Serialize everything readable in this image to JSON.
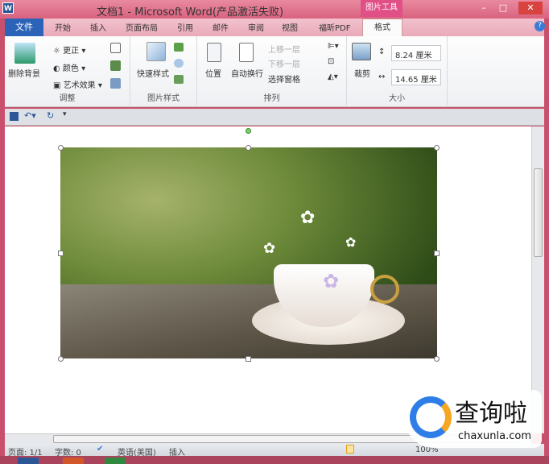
{
  "title": "文档1 - Microsoft Word(产品激活失败)",
  "context_tab": "图片工具",
  "window": {
    "minimize": "–",
    "maximize": "□",
    "close": "✕"
  },
  "tabs": [
    "文件",
    "开始",
    "插入",
    "页面布局",
    "引用",
    "邮件",
    "审阅",
    "视图",
    "福昕PDF",
    "格式"
  ],
  "ribbon": {
    "adjust": {
      "remove_bg": "删除背景",
      "corrections": "更正",
      "color": "颜色",
      "artistic": "艺术效果",
      "label": "调整"
    },
    "styles": {
      "quick": "快速样式",
      "label": "图片样式"
    },
    "arrange": {
      "position": "位置",
      "wrap": "自动换行",
      "forward": "上移一层",
      "backward": "下移一层",
      "pane": "选择窗格",
      "label": "排列"
    },
    "size": {
      "crop": "裁剪",
      "height": "8.24 厘米",
      "width": "14.65 厘米",
      "label": "大小"
    }
  },
  "status": {
    "page": "页面: 1/1",
    "words": "字数: 0",
    "lang": "英语(美国)",
    "mode": "插入",
    "zoom": "100%"
  },
  "watermark": {
    "name": "查询啦",
    "url": "chaxunla.com"
  },
  "colors": {
    "title": "#d9627f",
    "file_tab": "#2b63b8",
    "context": "#e04f86"
  }
}
